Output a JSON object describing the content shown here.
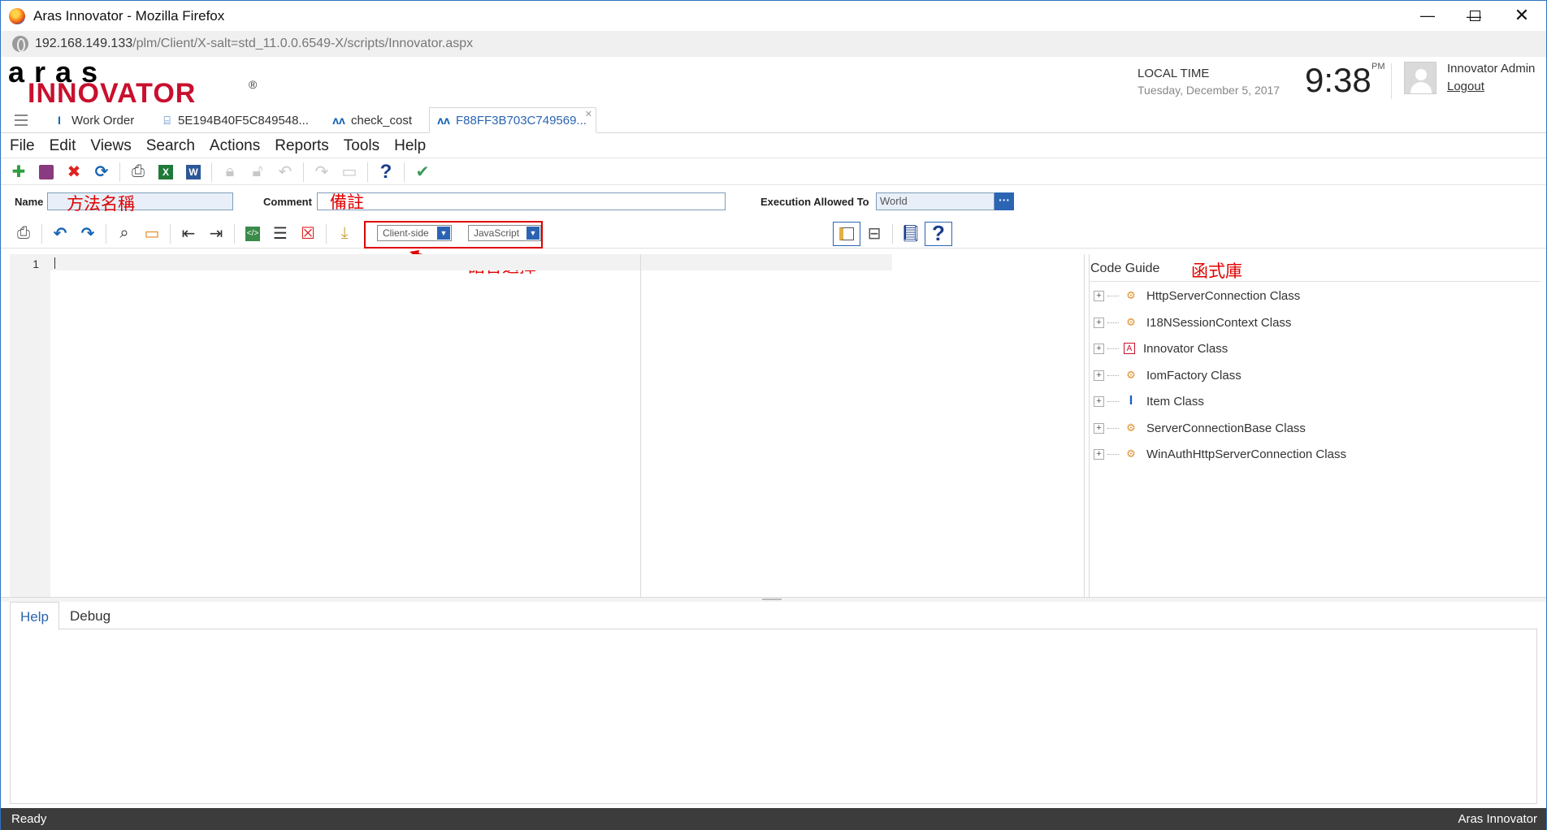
{
  "window": {
    "title": "Aras Innovator - Mozilla Firefox",
    "url_host": "192.168.149.133",
    "url_path": "/plm/Client/X-salt=std_11.0.0.6549-X/scripts/Innovator.aspx"
  },
  "header": {
    "logo_top": "aras",
    "logo_bottom": "INNOVATOR",
    "logo_reg": "®",
    "local_time_label": "LOCAL TIME",
    "date": "Tuesday, December 5, 2017",
    "time": "9:38",
    "ampm": "PM",
    "user_name": "Innovator Admin",
    "logout": "Logout"
  },
  "tabs": [
    {
      "label": "Work Order",
      "icon": "work-order-icon"
    },
    {
      "label": "5E194B40F5C849548...",
      "icon": "method-icon"
    },
    {
      "label": "check_cost",
      "icon": "workflow-icon"
    },
    {
      "label": "F88FF3B703C749569...",
      "icon": "workflow-icon"
    }
  ],
  "menu": [
    "File",
    "Edit",
    "Views",
    "Search",
    "Actions",
    "Reports",
    "Tools",
    "Help"
  ],
  "form": {
    "name_label": "Name",
    "name_annotation": "方法名稱",
    "comment_label": "Comment",
    "comment_annotation": "備註",
    "exec_label": "Execution Allowed To",
    "exec_value": "World",
    "exec_button": "···"
  },
  "editor_toolbar": {
    "location_value": "Client-side",
    "language_value": "JavaScript",
    "language_annotation": "語言選擇"
  },
  "editor": {
    "line_number": "1"
  },
  "code_guide": {
    "title": "Code Guide",
    "annotation": "函式庫",
    "items": [
      {
        "label": "HttpServerConnection Class",
        "icon": "class-icon"
      },
      {
        "label": "I18NSessionContext Class",
        "icon": "class-icon"
      },
      {
        "label": "Innovator Class",
        "icon": "innovator-class-icon"
      },
      {
        "label": "IomFactory Class",
        "icon": "class-icon"
      },
      {
        "label": "Item Class",
        "icon": "item-class-icon"
      },
      {
        "label": "ServerConnectionBase Class",
        "icon": "class-icon"
      },
      {
        "label": "WinAuthHttpServerConnection Class",
        "icon": "class-icon"
      }
    ]
  },
  "bottom_tabs": [
    "Help",
    "Debug"
  ],
  "status": {
    "left": "Ready",
    "right": "Aras Innovator"
  },
  "colors": {
    "accent": "#2c64b4",
    "annotation_red": "#e00000",
    "statusbar": "#3c3c3c"
  }
}
